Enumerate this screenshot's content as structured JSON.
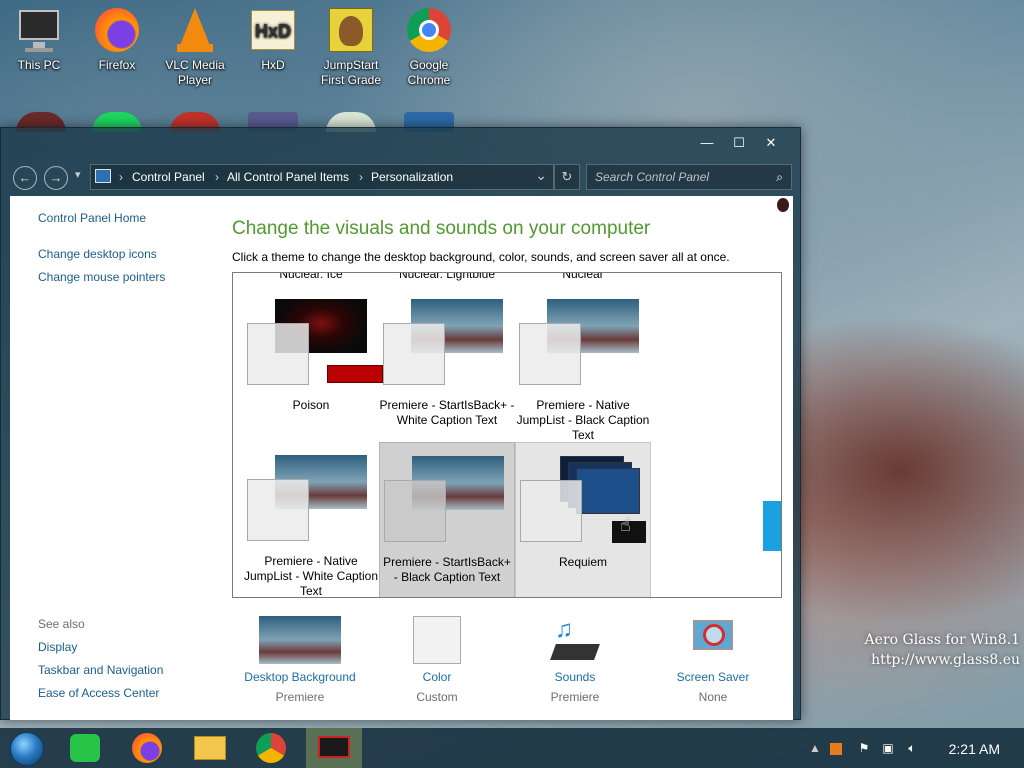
{
  "desktop": {
    "icons": [
      {
        "label": "This PC"
      },
      {
        "label": "Firefox"
      },
      {
        "label": "VLC Media Player"
      },
      {
        "label": "HxD"
      },
      {
        "label": "JumpStart First Grade"
      },
      {
        "label": "Google Chrome"
      }
    ],
    "watermark": {
      "line1": "Aero Glass for Win8.1",
      "line2": "http://www.glass8.eu"
    }
  },
  "window": {
    "controls": {
      "minimize": "—",
      "maximize": "☐",
      "close": "✕"
    },
    "nav": {
      "back": "←",
      "forward": "→",
      "recent": "▾"
    },
    "address": {
      "crumbs": [
        "Control Panel",
        "All Control Panel Items",
        "Personalization"
      ],
      "separator": "›",
      "dropdown": "⌄",
      "refresh": "↻"
    },
    "search": {
      "placeholder": "Search Control Panel",
      "icon": "⌕"
    },
    "sidebar": {
      "home": "Control Panel Home",
      "links": [
        "Change desktop icons",
        "Change mouse pointers"
      ],
      "see_also_title": "See also",
      "see_also": [
        "Display",
        "Taskbar and Navigation",
        "Ease of Access Center"
      ]
    },
    "heading": "Change the visuals and sounds on your computer",
    "subheading": "Click a theme to change the desktop background, color, sounds, and screen saver all at once.",
    "themes_cut": [
      "Nuclear. Ice",
      "Nuclear. Lightblue",
      "Nuclear"
    ],
    "themes": [
      {
        "label": "Poison"
      },
      {
        "label": "Premiere - StartIsBack+ - White Caption Text"
      },
      {
        "label": "Premiere - Native JumpList - Black Caption Text"
      },
      {
        "label": "Premiere - Native JumpList - White Caption Text"
      },
      {
        "label": "Premiere - StartIsBack+ - Black Caption Text"
      },
      {
        "label": "Requiem"
      }
    ],
    "bottom": [
      {
        "label": "Desktop Background",
        "value": "Premiere"
      },
      {
        "label": "Color",
        "value": "Custom"
      },
      {
        "label": "Sounds",
        "value": "Premiere"
      },
      {
        "label": "Screen Saver",
        "value": "None"
      }
    ]
  },
  "taskbar": {
    "clock": "2:21 AM"
  },
  "colors": {
    "accent": "#4f9b2e",
    "link": "#1a5e91",
    "scroll": "#1ba1e2"
  }
}
